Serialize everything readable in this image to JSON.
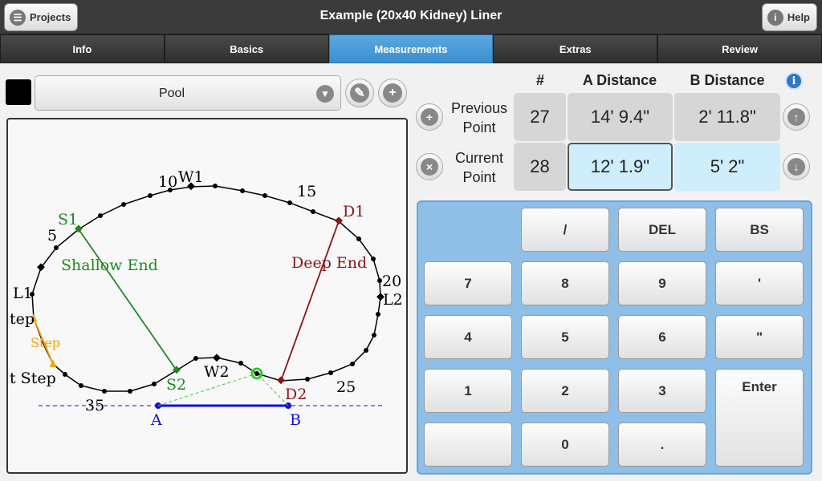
{
  "header": {
    "title": "Example (20x40 Kidney) Liner",
    "projects_label": "Projects",
    "help_label": "Help"
  },
  "tabs": [
    {
      "label": "Info"
    },
    {
      "label": "Basics"
    },
    {
      "label": "Measurements",
      "active": true
    },
    {
      "label": "Extras"
    },
    {
      "label": "Review"
    }
  ],
  "shape_selector": {
    "value": "Pool",
    "swatch_color": "#000000"
  },
  "measure_table": {
    "headers": {
      "num": "#",
      "a": "A Distance",
      "b": "B Distance"
    },
    "previous": {
      "label_line1": "Previous",
      "label_line2": "Point",
      "num": "27",
      "a": "14' 9.4\"",
      "b": "2' 11.8\""
    },
    "current": {
      "label_line1": "Current",
      "label_line2": "Point",
      "num": "28",
      "a": "12' 1.9\"",
      "b": "5' 2\""
    }
  },
  "keypad": {
    "slash": "/",
    "del": "DEL",
    "bs": "BS",
    "k7": "7",
    "k8": "8",
    "k9": "9",
    "feet": "'",
    "k4": "4",
    "k5": "5",
    "k6": "6",
    "inches": "\"",
    "k1": "1",
    "k2": "2",
    "k3": "3",
    "enter": "Enter",
    "k0": "0",
    "dot": "."
  },
  "diagram": {
    "labels": {
      "w1": "W1",
      "w2": "W2",
      "s1": "S1",
      "s2": "S2",
      "d1": "D1",
      "d2": "D2",
      "l1": "L1",
      "l2": "L2",
      "a": "A",
      "b": "B",
      "n5": "5",
      "n10": "10",
      "n15": "15",
      "n20": "20",
      "n25": "25",
      "n35": "35",
      "shallow_end": "Shallow End",
      "deep_end": "Deep End",
      "step": "Step",
      "tep": "tep",
      "t_step": "t Step"
    },
    "colors": {
      "outline": "#000000",
      "shallow": "#1e8a1e",
      "deep": "#8b1414",
      "step": "#f5a000",
      "baseline": "#1010e0",
      "current_point": "#33cc33"
    }
  }
}
